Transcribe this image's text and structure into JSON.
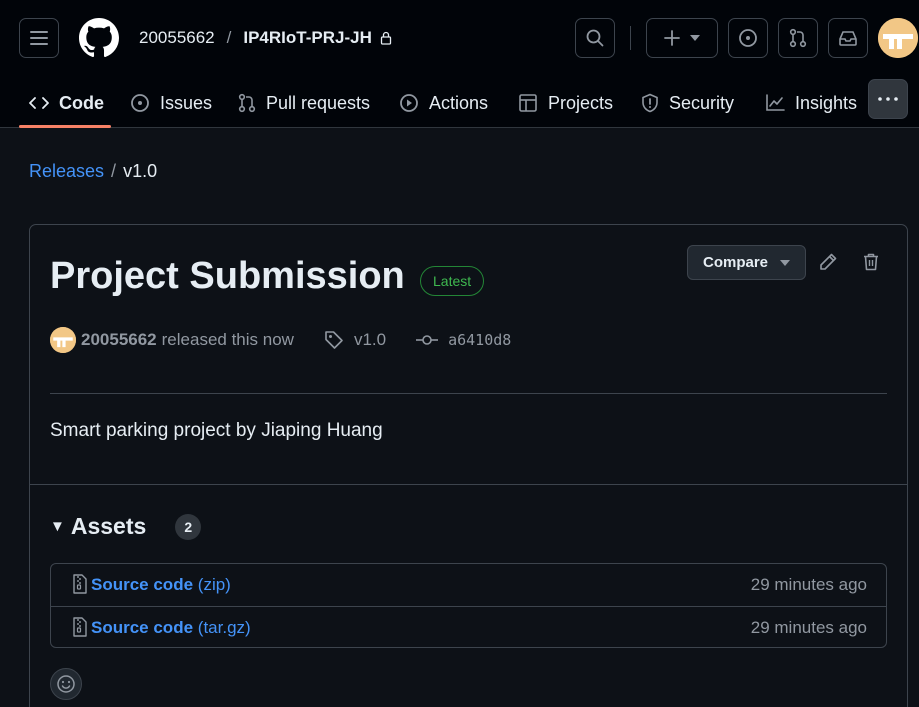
{
  "header": {
    "owner": "20055662",
    "separator": "/",
    "repo": "IP4RIoT-PRJ-JH"
  },
  "nav": {
    "items": [
      {
        "label": "Code",
        "icon": "code-icon",
        "active": true
      },
      {
        "label": "Issues",
        "icon": "issue-opened-icon"
      },
      {
        "label": "Pull requests",
        "icon": "git-pull-request-icon"
      },
      {
        "label": "Actions",
        "icon": "play-icon"
      },
      {
        "label": "Projects",
        "icon": "table-icon"
      },
      {
        "label": "Security",
        "icon": "shield-icon"
      },
      {
        "label": "Insights",
        "icon": "graph-icon"
      }
    ]
  },
  "breadcrumb": {
    "parent": "Releases",
    "separator": "/",
    "current": "v1.0"
  },
  "release": {
    "title": "Project Submission",
    "badge": "Latest",
    "compare_label": "Compare",
    "author": "20055662",
    "released_text": "released this now",
    "tag": "v1.0",
    "commit": "a6410d8",
    "description": "Smart parking project by Jiaping Huang"
  },
  "assets": {
    "title": "Assets",
    "count": "2",
    "items": [
      {
        "name": "Source code",
        "type": "(zip)",
        "time": "29 minutes ago"
      },
      {
        "name": "Source code",
        "type": "(tar.gz)",
        "time": "29 minutes ago"
      }
    ]
  },
  "colors": {
    "background": "#0d1117",
    "header_bg": "#010409",
    "link": "#4493f8",
    "latest_green": "#3fb950",
    "active_underline": "#f78166"
  }
}
